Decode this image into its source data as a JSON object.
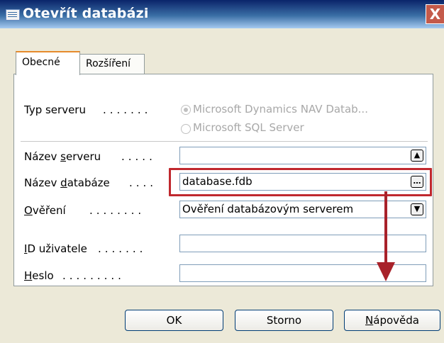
{
  "window": {
    "title": "Otevřít databázi",
    "close_glyph": "X"
  },
  "tabs": [
    {
      "label": "Obecné",
      "active": true
    },
    {
      "label": "Rozšíření",
      "active": false
    }
  ],
  "fields": {
    "server_type": {
      "label": "Typ serveru",
      "options": [
        {
          "label": "Microsoft Dynamics NAV Datab...",
          "selected": true
        },
        {
          "label": "Microsoft SQL Server",
          "selected": false
        }
      ]
    },
    "server_name": {
      "label_pre": "Název ",
      "label_acc": "s",
      "label_post": "erveru",
      "value": "",
      "button_icon": "up-arrow-icon"
    },
    "database_name": {
      "label_pre": "Název ",
      "label_acc": "d",
      "label_post": "atabáze",
      "value": "database.fdb",
      "button_icon": "ellipsis-icon"
    },
    "auth": {
      "label_acc": "O",
      "label_post": "věření",
      "value": "Ověření databázovým serverem",
      "button_icon": "dropdown-arrow-icon"
    },
    "user_id": {
      "label_acc": "I",
      "label_post": "D uživatele",
      "value": ""
    },
    "password": {
      "label_acc": "H",
      "label_post": "eslo",
      "value": ""
    }
  },
  "buttons": {
    "ok": "OK",
    "cancel": "Storno",
    "help_acc": "N",
    "help_post": "ápověda"
  },
  "annotation": {
    "highlight_color": "#c0282e"
  }
}
